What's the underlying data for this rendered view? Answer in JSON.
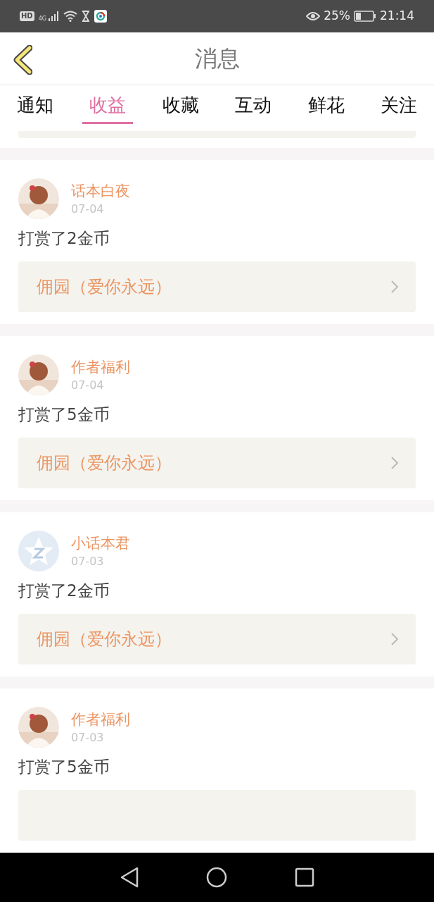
{
  "status_bar": {
    "hd": "HD",
    "network": "4G",
    "battery_percent": "25%",
    "time": "21:14"
  },
  "header": {
    "title": "消息"
  },
  "tabs": [
    {
      "label": "通知",
      "selected": false
    },
    {
      "label": "收益",
      "selected": true
    },
    {
      "label": "收藏",
      "selected": false
    },
    {
      "label": "互动",
      "selected": false
    },
    {
      "label": "鲜花",
      "selected": false
    },
    {
      "label": "关注",
      "selected": false
    }
  ],
  "messages": [
    {
      "name": "话本白夜",
      "date": "07-04",
      "text": "打赏了2金币",
      "link": "佣园（爱你永远）"
    },
    {
      "name": "作者福利",
      "date": "07-04",
      "text": "打赏了5金币",
      "link": "佣园（爱你永远）"
    },
    {
      "avatar": {
        "kind": "icon"
      },
      "name": "小话本君",
      "date": "07-03",
      "text": "打赏了2金币",
      "link": "佣园（爱你永远）"
    },
    {
      "name": "作者福利",
      "date": "07-03",
      "text": "打赏了5金币"
    }
  ]
}
